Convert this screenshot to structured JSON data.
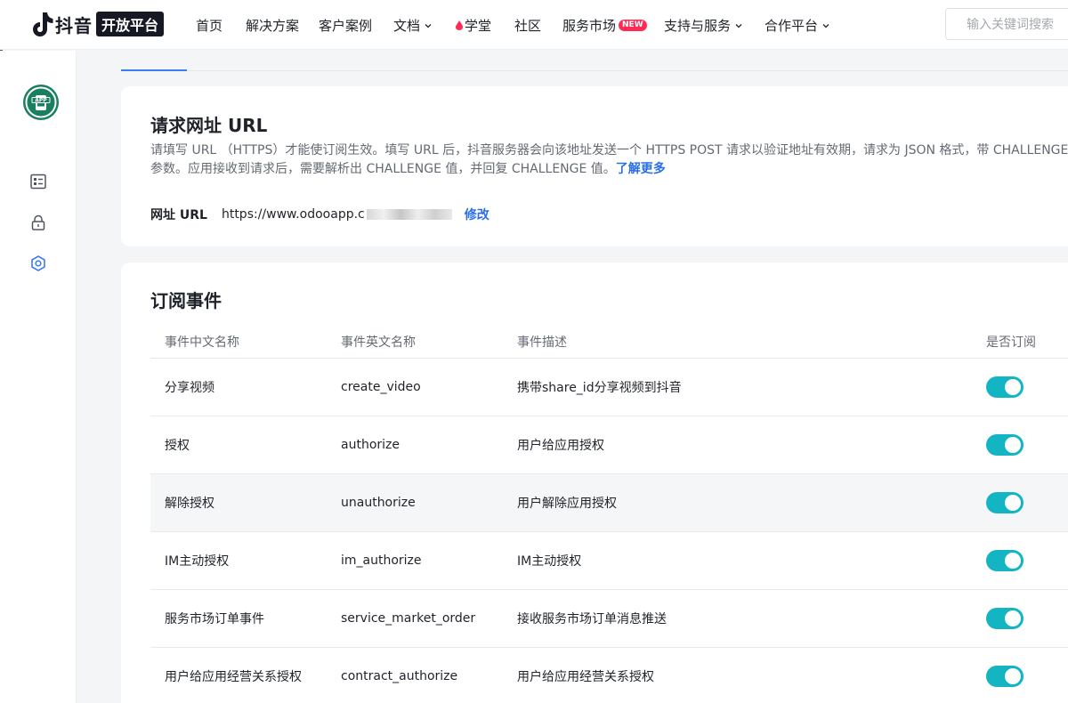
{
  "brand": {
    "name": "抖音",
    "badge": "开放平台"
  },
  "nav": {
    "items": [
      {
        "label": "首页"
      },
      {
        "label": "解决方案"
      },
      {
        "label": "客户案例"
      },
      {
        "label": "文档"
      },
      {
        "label": "学堂"
      },
      {
        "label": "社区"
      },
      {
        "label": "服务市场",
        "badge": "NEW"
      },
      {
        "label": "支持与服务"
      },
      {
        "label": "合作平台"
      }
    ]
  },
  "search": {
    "placeholder": "输入关键词搜索"
  },
  "sidebar": {
    "app_icon_label": "APP"
  },
  "url_section": {
    "title": "请求网址 URL",
    "desc_line1": "请填写 URL （HTTPS）才能使订阅生效。填写 URL 后，抖音服务器会向该地址发送一个 HTTPS POST 请求以验证地址有效期，请求为 JSON 格式，带 CHALLENGE",
    "desc_line2": "参数。应用接收到请求后，需要解析出 CHALLENGE 值，并回复 CHALLENGE 值。",
    "learn_more": "了解更多",
    "field_label": "网址 URL",
    "field_value": "https://www.odooapp.c",
    "edit_label": "修改"
  },
  "events": {
    "title": "订阅事件",
    "columns": [
      "事件中文名称",
      "事件英文名称",
      "事件描述",
      "是否订阅"
    ],
    "rows": [
      {
        "cn": "分享视频",
        "en": "create_video",
        "desc": "携带share_id分享视频到抖音",
        "subscribed": true
      },
      {
        "cn": "授权",
        "en": "authorize",
        "desc": "用户给应用授权",
        "subscribed": true
      },
      {
        "cn": "解除授权",
        "en": "unauthorize",
        "desc": "用户解除应用授权",
        "subscribed": true
      },
      {
        "cn": "IM主动授权",
        "en": "im_authorize",
        "desc": "IM主动授权",
        "subscribed": true
      },
      {
        "cn": "服务市场订单事件",
        "en": "service_market_order",
        "desc": "接收服务市场订单消息推送",
        "subscribed": true
      },
      {
        "cn": "用户给应用经营关系授权",
        "en": "contract_authorize",
        "desc": "用户给应用经营关系授权",
        "subscribed": true
      }
    ]
  },
  "colors": {
    "accent": "#2a6ee8",
    "toggle_on": "#13b5c2",
    "app_icon": "#1a7f61"
  }
}
